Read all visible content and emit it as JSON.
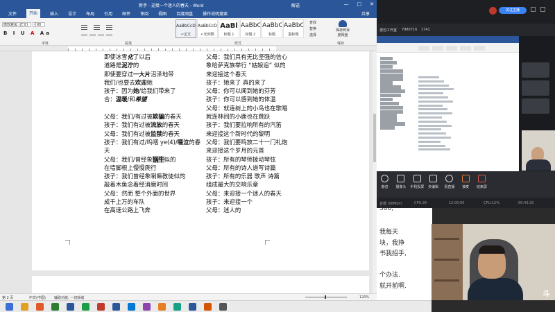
{
  "word": {
    "title": "新手 - 迎接一个迷人的春天 - Word",
    "user": "解语",
    "window_buttons": [
      "—",
      "□",
      "✕"
    ],
    "tabs": [
      "文件",
      "开始",
      "插入",
      "设计",
      "布局",
      "引用",
      "邮件",
      "审阅",
      "视图",
      "百度网盘",
      "操作说明搜索"
    ],
    "active_tab": "开始",
    "share_label": "共享",
    "ribbon": {
      "font_name": "微软雅黑 (正文)",
      "font_size": "小四",
      "group_font": "字体",
      "group_paragraph": "段落",
      "group_styles": "样式",
      "group_save": "保存",
      "styles": [
        {
          "preview": "AaBbCcDc",
          "name": "↵正文",
          "size": "small"
        },
        {
          "preview": "AaBbCcDc",
          "name": "↵无间隔",
          "size": "small"
        },
        {
          "preview": "AaBl",
          "name": "标题 1",
          "size": "big"
        },
        {
          "preview": "AaBbC",
          "name": "标题 2",
          "size": "mid"
        },
        {
          "preview": "AaBbC",
          "name": "标题",
          "size": "mid"
        },
        {
          "preview": "AaBbC",
          "name": "副标题",
          "size": "mid"
        }
      ],
      "editing": [
        "查找",
        "替换",
        "选择"
      ],
      "save_button": "保存到百度网盘"
    },
    "document": {
      "left_column": [
        [
          {
            "t": "即使冰雪"
          },
          {
            "t": "化",
            "s": "bi"
          },
          {
            "t": "了以后"
          }
        ],
        [
          {
            "t": "道路是"
          },
          {
            "t": "泥泞",
            "s": "b"
          },
          {
            "t": "的"
          }
        ],
        [
          {
            "t": "即使要穿过"
          },
          {
            "t": "一大片",
            "s": "b"
          },
          {
            "t": "沼泽地带"
          }
        ],
        [
          {
            "t": "我们/也要去"
          },
          {
            "t": "欢迎",
            "s": "b"
          },
          {
            "t": "她"
          }
        ],
        [
          {
            "t": "孩子：因为"
          },
          {
            "t": "她",
            "s": "b"
          },
          {
            "t": "/给我们带来了"
          }
        ],
        [
          {
            "t": "合："
          },
          {
            "t": "温暖",
            "s": "b"
          },
          {
            "t": "/和"
          },
          {
            "t": "希望",
            "s": "bi"
          }
        ],
        [
          {
            "t": ""
          }
        ],
        [
          {
            "t": "父母：我们/有过被"
          },
          {
            "t": "欺骗",
            "s": "b"
          },
          {
            "t": "的春天"
          }
        ],
        [
          {
            "t": "孩子：我们有过被"
          },
          {
            "t": "流放",
            "s": "b"
          },
          {
            "t": "的春天"
          }
        ],
        [
          {
            "t": "父母：我们有过被"
          },
          {
            "t": "监禁",
            "s": "b"
          },
          {
            "t": "的春天"
          }
        ],
        [
          {
            "t": "孩子：我们有过/呜咽 ye(4)/"
          },
          {
            "t": "啜泣",
            "s": "b"
          },
          {
            "t": "的春"
          }
        ],
        [
          {
            "t": "天"
          }
        ],
        [
          {
            "t": "父母：我们/曾经象"
          },
          {
            "t": "锅牛",
            "s": "bhl"
          },
          {
            "t": "似的"
          }
        ],
        [
          {
            "t": "在墙脚根上慢慢爬行"
          }
        ],
        [
          {
            "t": "孩子：我们曾经象喇嘛教徒似的"
          }
        ],
        [
          {
            "t": "敲着木鱼念着经消磨时间"
          }
        ],
        [
          {
            "t": "父母：然而  整个外面的世界"
          }
        ],
        [
          {
            "t": "成千上万的车队"
          }
        ],
        [
          {
            "t": "在高速公路上飞奔"
          }
        ]
      ],
      "right_column": [
        "父母：我们具有无比坚强的信心",
        "象哈萨克族举行 “姑娘追” 似的",
        "来迎接这个春天",
        "孩子：她来了  真的来了",
        "父母：你可以闻到她的芬芳",
        "孩子：你可以感到她的体温",
        "父母：就连树上的小鸟也在歌唱",
        "就连林间的小鹿也在跳跃",
        "孩子：我们要拉响所有的汽笛",
        "来迎接这个新时代的黎明",
        "父母：我们要鸣放二十一门礼炮",
        "来迎接这个岁月的元首",
        "孩子：所有的琴师拨动琴弦",
        "父母：所有的诗人谱写诗篇",
        "孩子：所有的乐器  歌声  诗篇",
        "组成最大的交响乐章",
        "父母：来迎接一个迷人的春天",
        "孩子：来迎接一个",
        "父母：迷人的"
      ]
    },
    "status": {
      "page": "第 2 页",
      "language": "中文(中国)",
      "accessibility": "辅助功能: 一切就绪",
      "zoom": "120%"
    }
  },
  "meeting": {
    "top_button": "关注主播",
    "sub_left": "德迈工作室",
    "sub_id": "7980716",
    "sub_count": "1741",
    "toolbar": [
      {
        "label": "静音",
        "icon": "microphone-icon"
      },
      {
        "label": "摄像头",
        "icon": "camera-icon"
      },
      {
        "label": "手机投屏",
        "icon": "phone-cast-icon"
      },
      {
        "label": "多编辑",
        "icon": "edit-icon"
      },
      {
        "label": "看直播",
        "icon": "live-icon"
      },
      {
        "label": "抽麦",
        "icon": "hand-icon"
      },
      {
        "label": "结束屏",
        "icon": "end-icon"
      }
    ],
    "status_items": [
      "直播 (98Mbit)",
      "CPU:26",
      "12:00:00",
      "CPU:12%",
      "00:43:20"
    ]
  },
  "background_doc": {
    "lines": [
      "500,",
      "",
      "我每天",
      "块，我挣",
      "书我招手,",
      "",
      "个办法.",
      "就开前啊."
    ]
  },
  "webcam": {
    "logo": "斗鱼"
  },
  "colors": {
    "word_blue": "#2b579a",
    "meet_bg": "#202226"
  }
}
